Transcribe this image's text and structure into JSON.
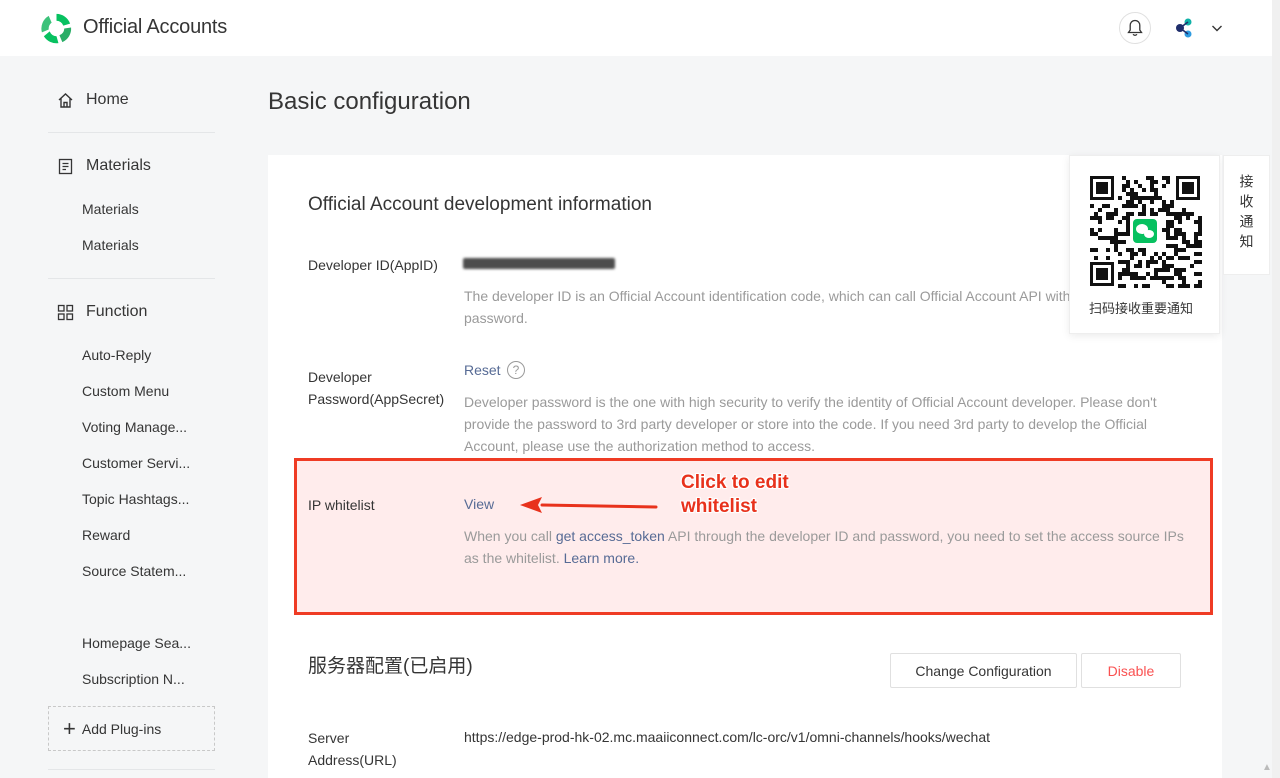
{
  "header": {
    "brand": "Official Accounts"
  },
  "sidebar": {
    "home": "Home",
    "materials": {
      "title": "Materials",
      "items": [
        "Materials",
        "Materials"
      ]
    },
    "function": {
      "title": "Function",
      "items": [
        "Auto-Reply",
        "Custom Menu",
        "Voting Manage...",
        "Customer Servi...",
        "Topic Hashtags...",
        "Reward",
        "Source Statem..."
      ]
    },
    "plugins": [
      "Homepage Sea...",
      "Subscription N..."
    ],
    "add_plugins": "Add Plug-ins"
  },
  "main": {
    "page_title": "Basic configuration",
    "dev_info": {
      "title": "Official Account development information",
      "developer_id": {
        "label": "Developer ID(AppID)",
        "desc": "The developer ID is an Official Account identification code, which can call Official Account API with developer's password."
      },
      "developer_password": {
        "label": "Developer Password(AppSecret)",
        "action": "Reset",
        "help": "?",
        "desc": "Developer password is the one with high security to verify the identity of Official Account developer. Please don't provide the password to 3rd party developer or store into the code. If you need 3rd party to develop the Official Account, please use the authorization method to access."
      },
      "ip_whitelist": {
        "label": "IP whitelist",
        "action": "View",
        "desc_prefix": "When you call ",
        "desc_link": "get access_token",
        "desc_middle": " API through the developer ID and password, you need to set the access source IPs as the whitelist. ",
        "desc_learn": "Learn more."
      }
    },
    "annotation": {
      "line1": "Click to edit",
      "line2": "whitelist"
    },
    "server_config": {
      "title": "服务器配置(已启用)",
      "change_button": "Change Configuration",
      "disable_button": "Disable",
      "server_address": {
        "label": "Server Address(URL)",
        "value": "https://edge-prod-hk-02.mc.maaiiconnect.com/lc-orc/v1/omni-channels/hooks/wechat"
      }
    }
  },
  "qr_popup": {
    "caption": "扫码接收重要通知",
    "side_tab": "接收通知"
  },
  "colors": {
    "brand_green": "#07c160",
    "link": "#576b95",
    "danger": "#fa5151",
    "annotation_red": "#ef3b24"
  }
}
